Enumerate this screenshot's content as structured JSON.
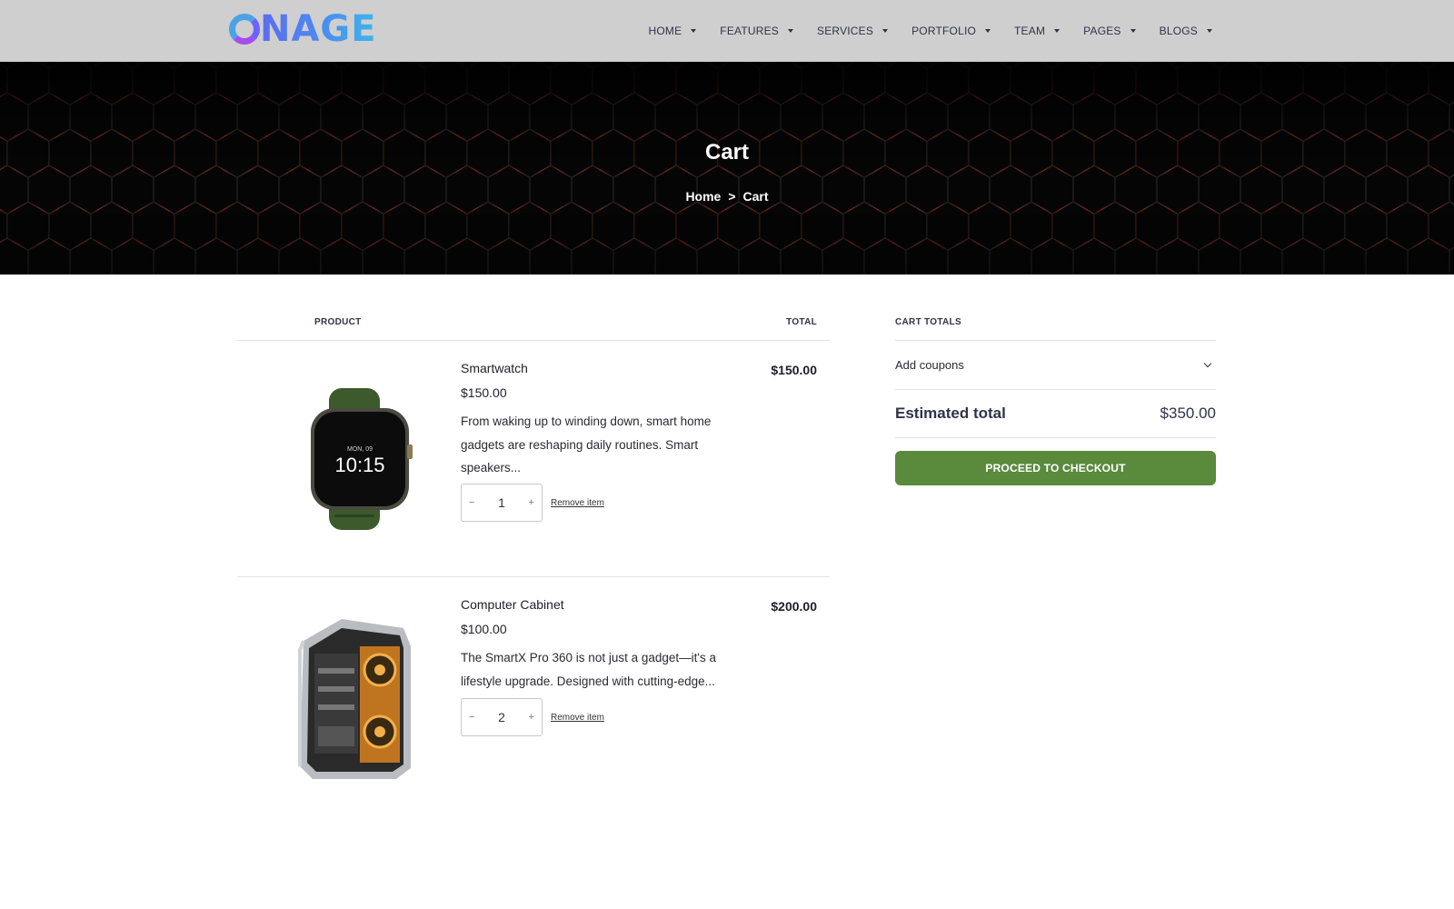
{
  "brand": {
    "logo_text": "NAGE"
  },
  "nav": {
    "items": [
      {
        "label": "HOME"
      },
      {
        "label": "FEATURES"
      },
      {
        "label": "SERVICES"
      },
      {
        "label": "PORTFOLIO"
      },
      {
        "label": "TEAM"
      },
      {
        "label": "PAGES"
      },
      {
        "label": "BLOGS"
      }
    ]
  },
  "hero": {
    "title": "Cart",
    "breadcrumb": {
      "home": "Home",
      "separator": ">",
      "current": "Cart"
    }
  },
  "cart": {
    "headers": {
      "product": "PRODUCT",
      "total": "TOTAL"
    },
    "items": [
      {
        "name": "Smartwatch",
        "price": "$150.00",
        "description": "From waking up to winding down, smart home gadgets are reshaping daily routines. Smart speakers...",
        "quantity": "1",
        "minus": "−",
        "plus": "+",
        "remove_label": "Remove item",
        "total": "$150.00",
        "watch_day": "MON, 09",
        "watch_time": "10:15"
      },
      {
        "name": "Computer Cabinet",
        "price": "$100.00",
        "description": "The SmartX Pro 360 is not just a gadget—it's a lifestyle upgrade. Designed with cutting-edge...",
        "quantity": "2",
        "minus": "−",
        "plus": "+",
        "remove_label": "Remove item",
        "total": "$200.00"
      }
    ]
  },
  "totals": {
    "heading": "CART TOTALS",
    "coupon_label": "Add coupons",
    "estimated_label": "Estimated total",
    "estimated_value": "$350.00",
    "checkout_label": "PROCEED TO CHECKOUT"
  },
  "colors": {
    "header_bg": "#cfcfcf",
    "hero_bg": "#050505",
    "hex_accent": "#a3351c",
    "checkout_button": "#5a8a3c"
  }
}
